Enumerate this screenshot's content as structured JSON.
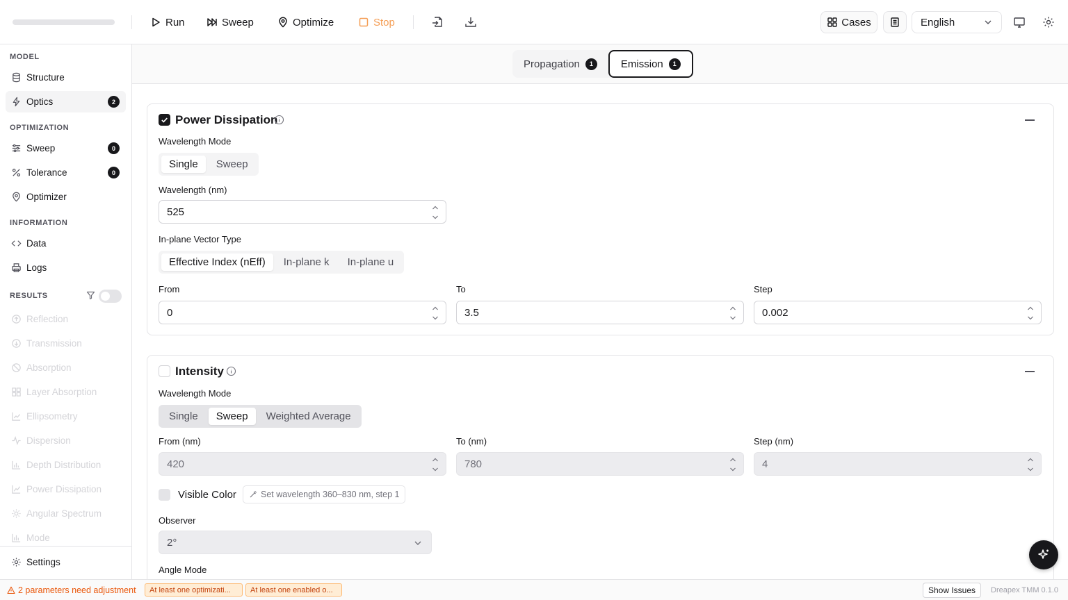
{
  "toolbar": {
    "run_label": "Run",
    "sweep_label": "Sweep",
    "optimize_label": "Optimize",
    "stop_label": "Stop",
    "cases_label": "Cases",
    "language_value": "English"
  },
  "sidebar": {
    "sections": {
      "model": "MODEL",
      "optimization": "OPTIMIZATION",
      "information": "INFORMATION",
      "results": "RESULTS"
    },
    "model_items": [
      {
        "label": "Structure",
        "icon": "database-icon"
      },
      {
        "label": "Optics",
        "icon": "lightning-icon",
        "badge": "2",
        "active": true
      }
    ],
    "optimization_items": [
      {
        "label": "Sweep",
        "icon": "sliders-icon",
        "badge": "0"
      },
      {
        "label": "Tolerance",
        "icon": "percent-icon",
        "badge": "0"
      },
      {
        "label": "Optimizer",
        "icon": "map-pin-icon"
      }
    ],
    "information_items": [
      {
        "label": "Data",
        "icon": "code-icon"
      },
      {
        "label": "Logs",
        "icon": "printer-icon"
      }
    ],
    "results_items": [
      {
        "label": "Reflection"
      },
      {
        "label": "Transmission"
      },
      {
        "label": "Absorption"
      },
      {
        "label": "Layer Absorption"
      },
      {
        "label": "Ellipsometry"
      },
      {
        "label": "Dispersion"
      },
      {
        "label": "Depth Distribution"
      },
      {
        "label": "Power Dissipation"
      },
      {
        "label": "Angular Spectrum"
      },
      {
        "label": "Mode"
      }
    ],
    "results_filter_enabled": false,
    "settings_label": "Settings"
  },
  "tabs": [
    {
      "label": "Propagation",
      "badge": "1",
      "active": false
    },
    {
      "label": "Emission",
      "badge": "1",
      "active": true
    }
  ],
  "power_dissipation": {
    "title": "Power Dissipation",
    "enabled": true,
    "wavelength_mode_label": "Wavelength Mode",
    "wavelength_modes": [
      "Single",
      "Sweep"
    ],
    "wavelength_mode_selected": "Single",
    "wavelength_label": "Wavelength (nm)",
    "wavelength_value": "525",
    "vector_type_label": "In-plane Vector Type",
    "vector_types": [
      "Effective Index (nEff)",
      "In-plane k",
      "In-plane u"
    ],
    "vector_type_selected": "Effective Index (nEff)",
    "from_label": "From",
    "from_value": "0",
    "to_label": "To",
    "to_value": "3.5",
    "step_label": "Step",
    "step_value": "0.002"
  },
  "intensity": {
    "title": "Intensity",
    "enabled": false,
    "wavelength_mode_label": "Wavelength Mode",
    "wavelength_modes": [
      "Single",
      "Sweep",
      "Weighted Average"
    ],
    "wavelength_mode_selected": "Sweep",
    "from_label": "From (nm)",
    "from_value": "420",
    "to_label": "To (nm)",
    "to_value": "780",
    "step_label": "Step (nm)",
    "step_value": "4",
    "visible_color_label": "Visible Color",
    "visible_color_checked": false,
    "set_wavelength_label": "Set wavelength 360–830 nm, step 1",
    "observer_label": "Observer",
    "observer_value": "2°",
    "angle_mode_label": "Angle Mode"
  },
  "status": {
    "warning": "2 parameters need adjustment",
    "chips": [
      "At least one optimizati...",
      "At least one enabled o..."
    ],
    "show_issues_label": "Show Issues",
    "version": "Dreapex TMM 0.1.0"
  },
  "colors": {
    "accent": "#18181b",
    "stop": "#f59e55",
    "warning": "#ea580c"
  }
}
